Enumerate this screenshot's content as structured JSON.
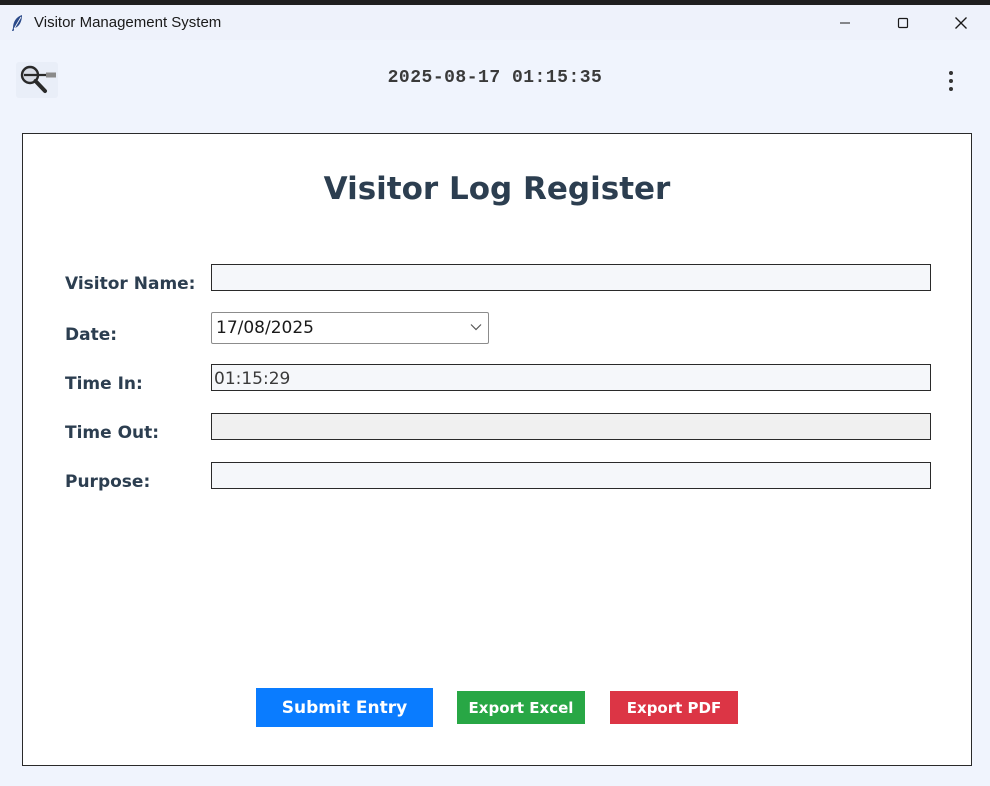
{
  "window": {
    "title": "Visitor Management System",
    "controls": [
      "minimize-icon",
      "maximize-icon",
      "close-icon"
    ]
  },
  "toolbar": {
    "clock": "2025-08-17 01:15:35",
    "search_icon": "search-icon",
    "menu_icon": "kebab-menu-icon"
  },
  "form": {
    "title": "Visitor Log Register",
    "fields": {
      "visitor_name": {
        "label": "Visitor Name:",
        "value": ""
      },
      "date": {
        "label": "Date:",
        "value": "17/08/2025"
      },
      "time_in": {
        "label": "Time In:",
        "value": "01:15:29"
      },
      "time_out": {
        "label": "Time Out:",
        "value": ""
      },
      "purpose": {
        "label": "Purpose:",
        "value": ""
      }
    }
  },
  "actions": {
    "submit": {
      "label": "Submit Entry",
      "color": "#0a7cff"
    },
    "export_excel": {
      "label": "Export Excel",
      "color": "#28a745"
    },
    "export_pdf": {
      "label": "Export PDF",
      "color": "#dc3545"
    }
  },
  "colors": {
    "title_text": "#2c3e50",
    "background": "#f0f4fd",
    "card": "#ffffff"
  }
}
